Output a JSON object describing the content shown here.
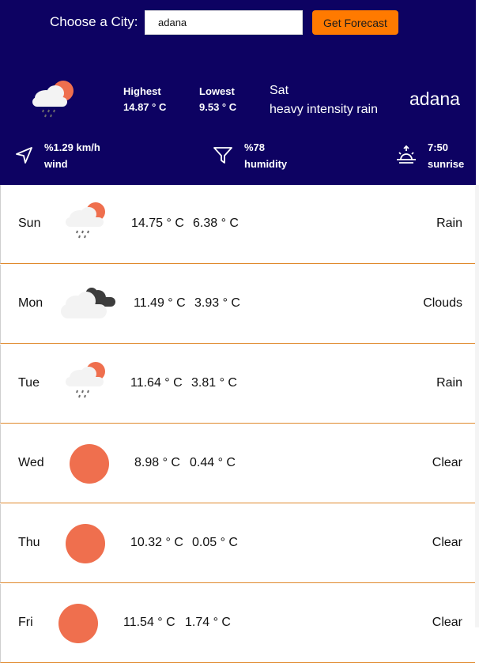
{
  "search": {
    "label": "Choose a City:",
    "value": "adana",
    "button_label": "Get Forecast"
  },
  "today": {
    "icon": "rain-icon",
    "highest_label": "Highest",
    "highest_value": "14.87 ° C",
    "lowest_label": "Lowest",
    "lowest_value": "9.53 ° C",
    "day": "Sat",
    "description": "heavy intensity rain",
    "city": "adana",
    "wind_value": "%1.29 km/h",
    "wind_label": "wind",
    "humidity_value": "%78",
    "humidity_label": "humidity",
    "sunrise_value": "7:50",
    "sunrise_label": "sunrise"
  },
  "forecast": [
    {
      "day": "Sun",
      "icon": "rain-icon",
      "high": "14.75 ° C",
      "low": "6.38 ° C",
      "condition": "Rain"
    },
    {
      "day": "Mon",
      "icon": "clouds-icon",
      "high": "11.49 ° C",
      "low": "3.93 ° C",
      "condition": "Clouds"
    },
    {
      "day": "Tue",
      "icon": "rain-icon",
      "high": "11.64 ° C",
      "low": "3.81 ° C",
      "condition": "Rain"
    },
    {
      "day": "Wed",
      "icon": "sun-icon",
      "high": "8.98 ° C",
      "low": "0.44 ° C",
      "condition": "Clear"
    },
    {
      "day": "Thu",
      "icon": "sun-icon",
      "high": "10.32 ° C",
      "low": "0.05 ° C",
      "condition": "Clear"
    },
    {
      "day": "Fri",
      "icon": "sun-icon",
      "high": "11.54 ° C",
      "low": "1.74 ° C",
      "condition": "Clear"
    }
  ],
  "colors": {
    "header_bg": "#0d0262",
    "accent": "#ff7a00",
    "sun": "#ef6f4e",
    "row_divider": "#e0892c"
  }
}
